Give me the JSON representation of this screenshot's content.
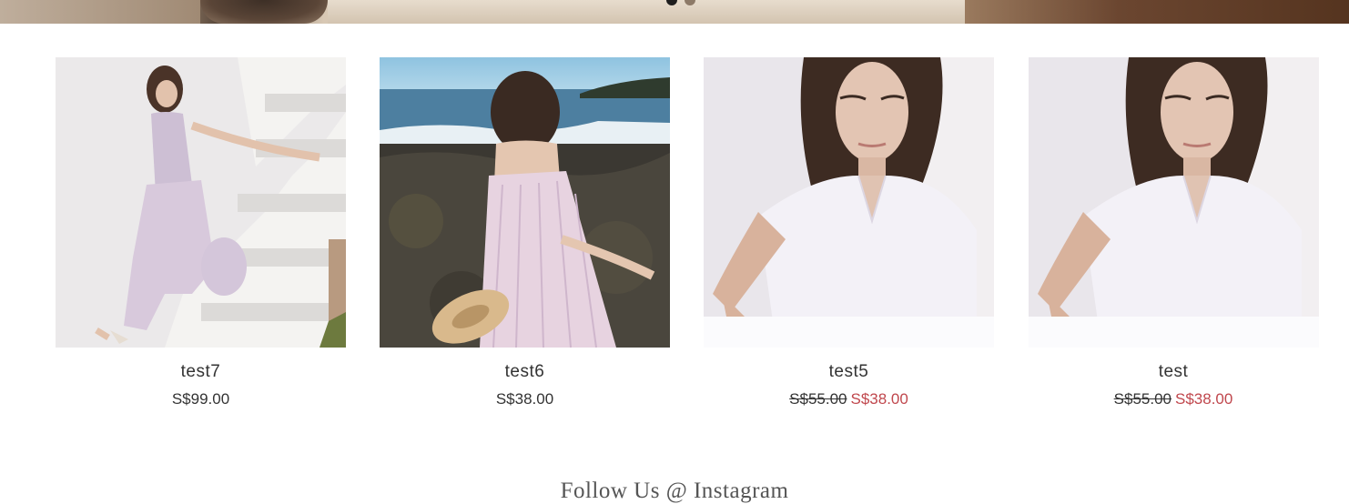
{
  "hero": {
    "slide_dots": [
      {
        "state": "active",
        "color": "#1e1e1e"
      },
      {
        "state": "inactive",
        "color": "#8d7a68"
      }
    ]
  },
  "products": [
    {
      "name": "test7",
      "price": "S$99.00",
      "original_price": "",
      "sale_price": "",
      "on_sale": false
    },
    {
      "name": "test6",
      "price": "S$38.00",
      "original_price": "",
      "sale_price": "",
      "on_sale": false
    },
    {
      "name": "test5",
      "price": "",
      "original_price": "S$55.00",
      "sale_price": "S$38.00",
      "on_sale": true
    },
    {
      "name": "test",
      "price": "",
      "original_price": "S$55.00",
      "sale_price": "S$38.00",
      "on_sale": true
    }
  ],
  "instagram": {
    "heading": "Follow Us @ Instagram"
  },
  "colors": {
    "sale_price": "#c0474d",
    "text": "#333333"
  }
}
